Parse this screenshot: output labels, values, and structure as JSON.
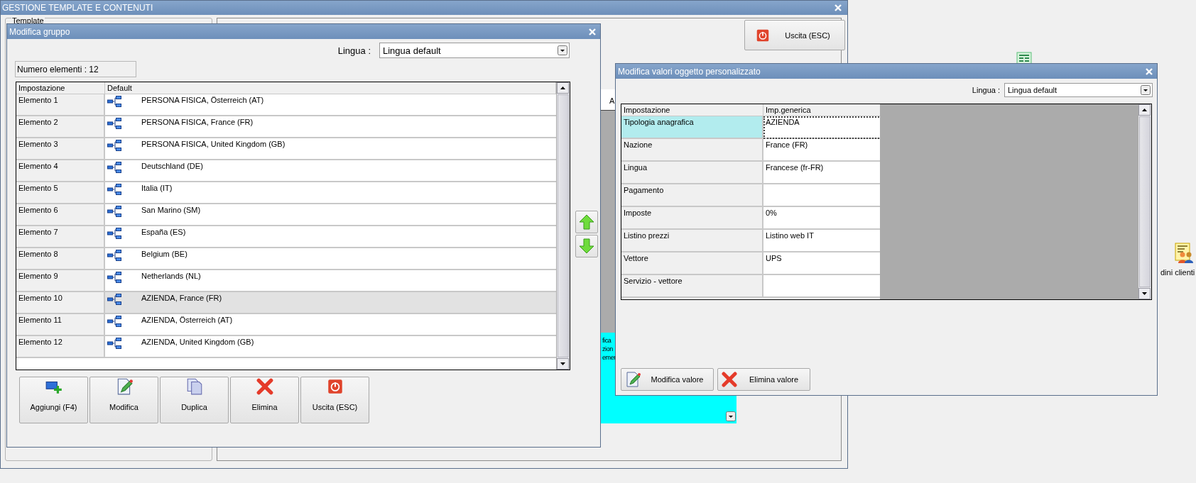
{
  "background_window": {
    "title": "GESTIONE TEMPLATE E CONTENUTI",
    "group_label": "Template",
    "exit_button": "Uscita (ESC)",
    "column_header": "A",
    "cyan_panel_lines": [
      "fica",
      "zion",
      "emer"
    ]
  },
  "desktop_icons": [
    {
      "kind": "list"
    },
    {
      "kind": "customers",
      "label": "dini clienti"
    }
  ],
  "group_dialog": {
    "title": "Modifica gruppo",
    "language_label": "Lingua :",
    "language_value": "Lingua default",
    "count_label": "Numero elementi : 12",
    "columns": [
      "Impostazione",
      "Default"
    ],
    "rows": [
      {
        "name": "Elemento 1",
        "value": "PERSONA FISICA, Österreich (AT)",
        "selected": false
      },
      {
        "name": "Elemento 2",
        "value": "PERSONA FISICA, France (FR)",
        "selected": false
      },
      {
        "name": "Elemento 3",
        "value": "PERSONA FISICA, United Kingdom (GB)",
        "selected": false
      },
      {
        "name": "Elemento 4",
        "value": "Deutschland (DE)",
        "selected": false
      },
      {
        "name": "Elemento 5",
        "value": "Italia (IT)",
        "selected": false
      },
      {
        "name": "Elemento 6",
        "value": "San Marino (SM)",
        "selected": false
      },
      {
        "name": "Elemento 7",
        "value": "España (ES)",
        "selected": false
      },
      {
        "name": "Elemento 8",
        "value": "Belgium (BE)",
        "selected": false
      },
      {
        "name": "Elemento 9",
        "value": "Netherlands (NL)",
        "selected": false
      },
      {
        "name": "Elemento 10",
        "value": "AZIENDA, France (FR)",
        "selected": true
      },
      {
        "name": "Elemento 11",
        "value": "AZIENDA, Österreich (AT)",
        "selected": false
      },
      {
        "name": "Elemento 12",
        "value": "AZIENDA, United Kingdom (GB)",
        "selected": false
      }
    ],
    "buttons": [
      {
        "label": "Aggiungi (F4)",
        "kind": "add"
      },
      {
        "label": "Modifica",
        "kind": "edit"
      },
      {
        "label": "Duplica",
        "kind": "duplicate"
      },
      {
        "label": "Elimina",
        "kind": "delete"
      },
      {
        "label": "Uscita (ESC)",
        "kind": "exit"
      }
    ]
  },
  "values_dialog": {
    "title": "Modifica valori oggetto personalizzato",
    "language_label": "Lingua :",
    "language_value": "Lingua default",
    "columns": [
      "Impostazione",
      "Imp.generica"
    ],
    "rows": [
      {
        "name": "Tipologia anagrafica",
        "value": "AZIENDA",
        "selected": true
      },
      {
        "name": "Nazione",
        "value": "France (FR)",
        "selected": false
      },
      {
        "name": "Lingua",
        "value": "Francese (fr-FR)",
        "selected": false
      },
      {
        "name": "Pagamento",
        "selected": false
      },
      {
        "name": "Imposte",
        "value": "0%",
        "selected": false
      },
      {
        "name": "Listino prezzi",
        "value": "Listino web IT",
        "selected": false
      },
      {
        "name": "Vettore",
        "value": "UPS",
        "selected": false
      },
      {
        "name": "Servizio - vettore",
        "selected": false
      }
    ],
    "buttons": [
      {
        "label": "Modifica valore",
        "kind": "edit"
      },
      {
        "label": "Elimina valore",
        "kind": "delete"
      }
    ]
  }
}
